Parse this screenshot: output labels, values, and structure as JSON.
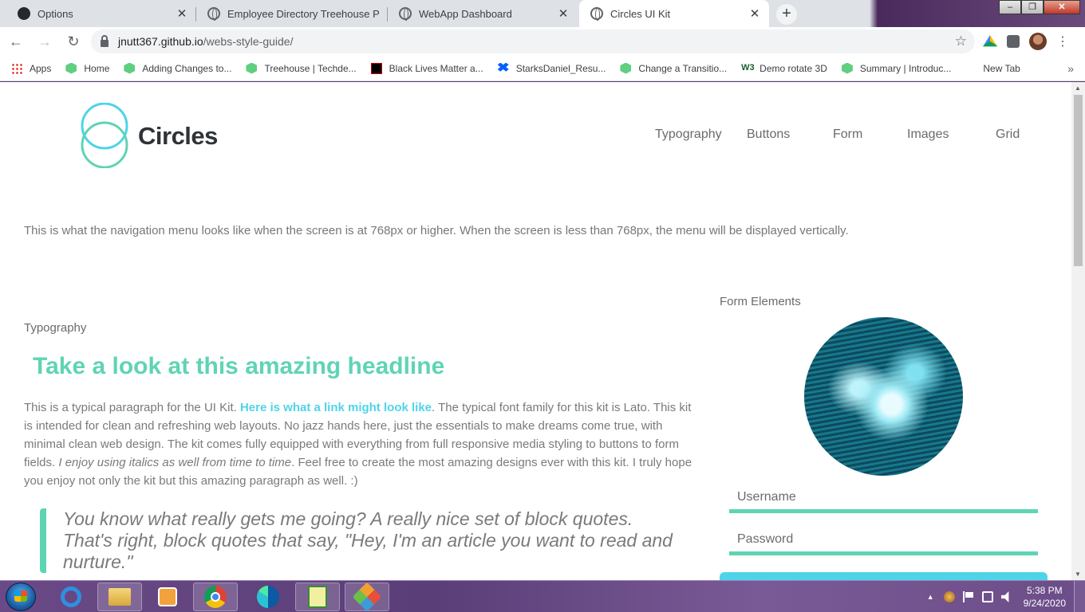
{
  "browser": {
    "tabs": [
      {
        "title": "Options",
        "favicon": "github-icon"
      },
      {
        "title": "Employee Directory Treehouse Pr",
        "favicon": "globe-icon"
      },
      {
        "title": "WebApp Dashboard",
        "favicon": "globe-icon"
      },
      {
        "title": "Circles UI Kit",
        "favicon": "globe-icon",
        "active": true
      }
    ],
    "window_controls": {
      "minimize": "–",
      "restore": "❐",
      "close": "✕"
    },
    "address": {
      "host": "jnutt367.github.io",
      "path": "/webs-style-guide/"
    },
    "bookmarks": [
      {
        "label": "Apps",
        "icon": "apps-grid-icon"
      },
      {
        "label": "Home",
        "icon": "treehouse-icon"
      },
      {
        "label": "Adding Changes to...",
        "icon": "treehouse-icon"
      },
      {
        "label": "Treehouse | Techde...",
        "icon": "treehouse-icon"
      },
      {
        "label": "Black Lives Matter a...",
        "icon": "blm-icon"
      },
      {
        "label": "StarksDaniel_Resu...",
        "icon": "dropbox-icon"
      },
      {
        "label": "Change a Transitio...",
        "icon": "treehouse-icon"
      },
      {
        "label": "Demo rotate 3D",
        "icon": "w3schools-icon"
      },
      {
        "label": "Summary | Introduc...",
        "icon": "treehouse-icon"
      },
      {
        "label": "New Tab",
        "icon": "none"
      }
    ],
    "bookmarks_more": "»"
  },
  "page": {
    "brand": "Circles",
    "nav": [
      "Typography",
      "Buttons",
      "Form",
      "Images",
      "Grid"
    ],
    "nav_note": "This is what the navigation menu looks like when the screen is at 768px or higher. When the screen is less than 768px, the menu will be displayed vertically.",
    "typography": {
      "label": "Typography",
      "headline": "Take a look at this amazing headline",
      "paragraph_start": "This is a typical paragraph for the UI Kit. ",
      "paragraph_link": "Here is what a link might look like",
      "paragraph_mid": ". The typical font family for this kit is Lato. This kit is intended for clean and refreshing web layouts. No jazz hands here, just the essentials to make dreams come true, with minimal clean web design. The kit comes fully equipped with everything from full responsive media styling to buttons to form fields. ",
      "paragraph_italic": "I enjoy using italics as well from time to time",
      "paragraph_end": ". Feel free to create the most amazing designs ever with this kit. I truly hope you enjoy not only the kit but this amazing paragraph as well. :)",
      "blockquote": "You know what really gets me going? A really nice set of block quotes. That's right, block quotes that say, \"Hey, I'm an article you want to read and nurture.\""
    },
    "form": {
      "label": "Form Elements",
      "username_placeholder": "Username",
      "password_placeholder": "Password"
    },
    "colors": {
      "accent_green": "#5fd4b4",
      "accent_cyan": "#4ed4e8",
      "text_gray": "#7a7a7a"
    }
  },
  "taskbar": {
    "apps": [
      "internet-explorer-icon",
      "file-explorer-icon",
      "media-player-icon",
      "chrome-icon",
      "edge-icon",
      "notepad-icon",
      "git-icon"
    ],
    "time": "5:38 PM",
    "date": "9/24/2020"
  }
}
